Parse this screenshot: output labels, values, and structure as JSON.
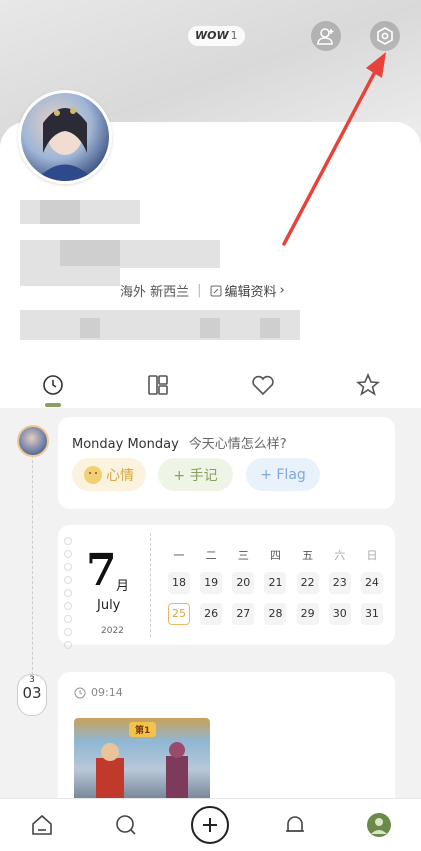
{
  "header": {
    "wow_label": "WOW",
    "wow_count": "1",
    "add_friend_icon": "add-friend-icon",
    "settings_icon": "settings-hexagon-icon"
  },
  "profile": {
    "location": "海外 新西兰",
    "edit_label": "编辑资料",
    "edit_chevron": "›"
  },
  "tabs": [
    {
      "icon": "clock-icon",
      "active": true
    },
    {
      "icon": "grid-icon",
      "active": false
    },
    {
      "icon": "heart-icon",
      "active": false
    },
    {
      "icon": "star-icon",
      "active": false
    }
  ],
  "mood_card": {
    "title": "Monday Monday",
    "question": "今天心情怎么样?",
    "chips": [
      "心情",
      "+ 手记",
      "+ Flag"
    ]
  },
  "calendar": {
    "month_number": "7",
    "month_unit": "月",
    "month_name": "July",
    "year": "2022",
    "weekdays": [
      "一",
      "二",
      "三",
      "四",
      "五",
      "六",
      "日"
    ],
    "week1": [
      "18",
      "19",
      "20",
      "21",
      "22",
      "23",
      "24"
    ],
    "week2": [
      "25",
      "26",
      "27",
      "28",
      "29",
      "30",
      "31"
    ],
    "today": "25"
  },
  "post": {
    "date_month": "3",
    "date_day": "03",
    "time": "09:14",
    "image_badge": "第1"
  },
  "colors": {
    "accent_green": "#8aa060",
    "mood_yellow": "#d9a640",
    "flag_blue": "#7fa8e0",
    "arrow_red": "#e8433a"
  }
}
